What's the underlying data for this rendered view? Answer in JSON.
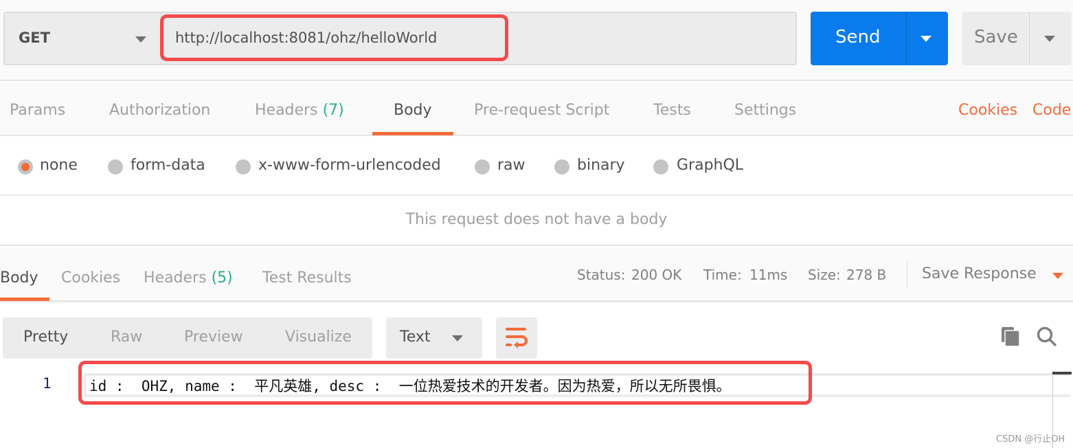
{
  "request": {
    "method": "GET",
    "url": "http://localhost:8081/ohz/helloWorld",
    "send_label": "Send",
    "save_label": "Save"
  },
  "request_tabs": [
    {
      "label": "Params"
    },
    {
      "label": "Authorization"
    },
    {
      "label": "Headers",
      "count": "(7)"
    },
    {
      "label": "Body",
      "active": true
    },
    {
      "label": "Pre-request Script"
    },
    {
      "label": "Tests"
    },
    {
      "label": "Settings"
    }
  ],
  "request_links": {
    "cookies": "Cookies",
    "code": "Code"
  },
  "body_types": [
    {
      "label": "none",
      "selected": true
    },
    {
      "label": "form-data"
    },
    {
      "label": "x-www-form-urlencoded"
    },
    {
      "label": "raw"
    },
    {
      "label": "binary"
    },
    {
      "label": "GraphQL"
    }
  ],
  "no_body_message": "This request does not have a body",
  "response_tabs": [
    {
      "label": "Body",
      "active": true
    },
    {
      "label": "Cookies"
    },
    {
      "label": "Headers",
      "count": "(5)"
    },
    {
      "label": "Test Results"
    }
  ],
  "response_meta": {
    "status_label": "Status:",
    "status": "200 OK",
    "time_label": "Time:",
    "time": "11ms",
    "size_label": "Size:",
    "size": "278 B",
    "save_response": "Save Response"
  },
  "view_modes": [
    "Pretty",
    "Raw",
    "Preview",
    "Visualize"
  ],
  "format": "Text",
  "response_body": {
    "line_number": "1",
    "text": "id :  OHZ, name :  平凡英雄, desc :  一位热爱技术的开发者。因为热爱，所以无所畏惧。"
  },
  "watermark": "CSDN @行止OH",
  "colors": {
    "accent": "#f26b3a",
    "send": "#097bed",
    "success": "#26b47f",
    "highlight": "#f24b4b"
  }
}
